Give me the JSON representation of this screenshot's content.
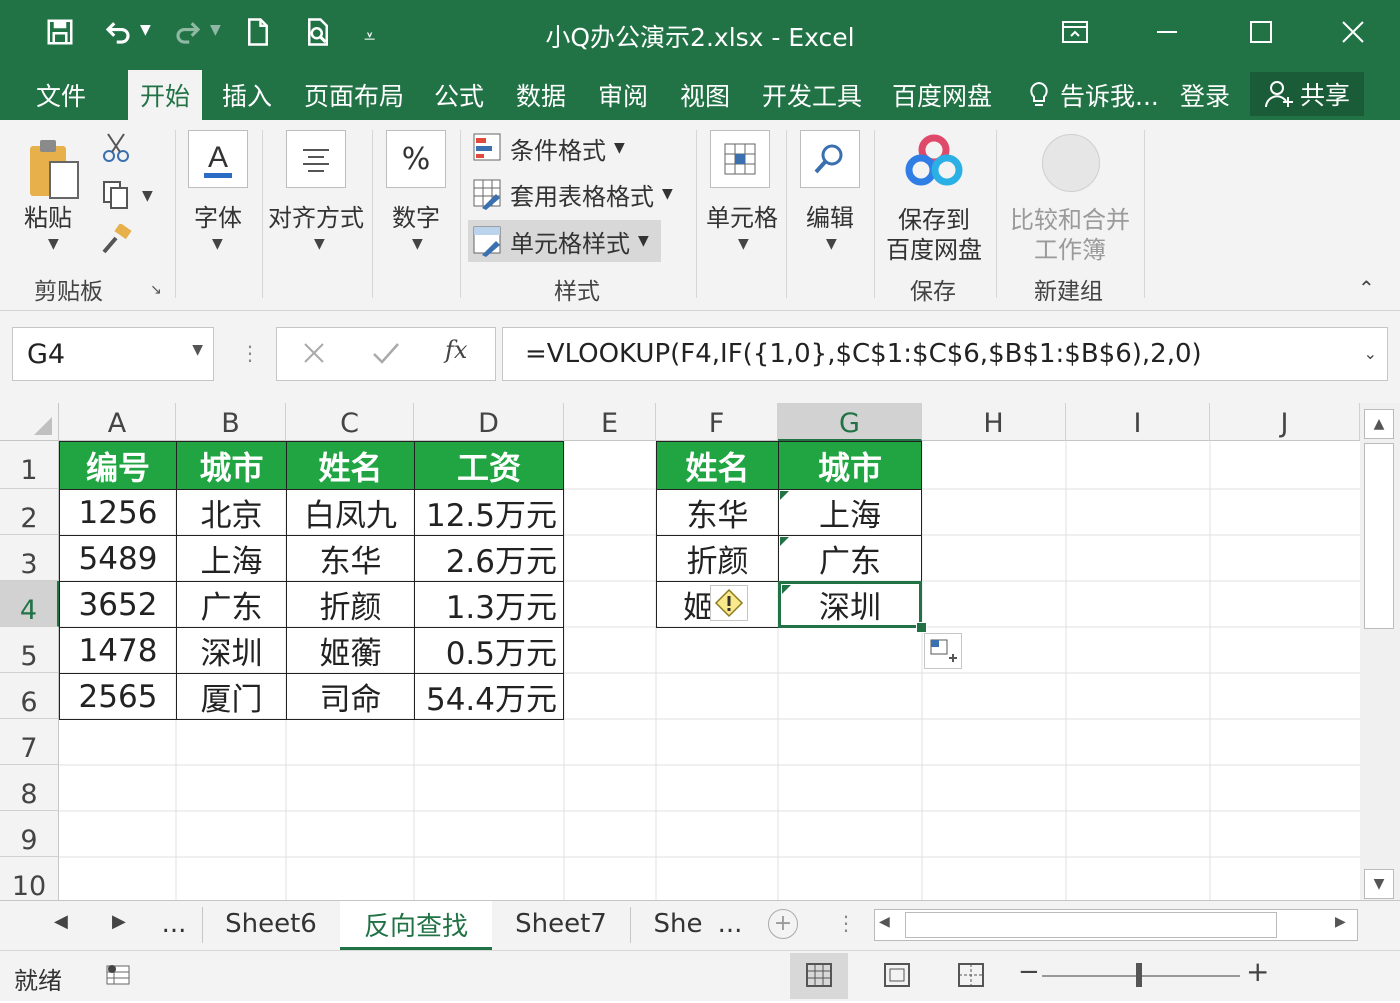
{
  "window": {
    "title": "小Q办公演示2.xlsx - Excel"
  },
  "ribbon_tabs": [
    "文件",
    "开始",
    "插入",
    "页面布局",
    "公式",
    "数据",
    "审阅",
    "视图",
    "开发工具",
    "百度网盘"
  ],
  "tell_me": "告诉我...",
  "login": "登录",
  "share": "共享",
  "ribbon": {
    "paste": "粘贴",
    "clipboard": "剪贴板",
    "font": "字体",
    "align": "对齐方式",
    "number": "数字",
    "cond_format": "条件格式",
    "table_format": "套用表格格式",
    "cell_style": "单元格样式",
    "styles": "样式",
    "cells": "单元格",
    "editing": "编辑",
    "save_to_line1": "保存到",
    "save_to_line2": "百度网盘",
    "save_group": "保存",
    "compare_line1": "比较和合并",
    "compare_line2": "工作簿",
    "new_group": "新建组"
  },
  "formula_bar": {
    "name_box": "G4",
    "formula": "=VLOOKUP(F4,IF({1,0},$C$1:$C$6,$B$1:$B$6),2,0)"
  },
  "grid": {
    "columns": [
      "A",
      "B",
      "C",
      "D",
      "E",
      "F",
      "G",
      "H",
      "I",
      "J"
    ],
    "rows": [
      "1",
      "2",
      "3",
      "4",
      "5",
      "6",
      "7",
      "8",
      "9",
      "10"
    ],
    "table1": {
      "headers": [
        "编号",
        "城市",
        "姓名",
        "工资"
      ],
      "rows": [
        [
          "1256",
          "北京",
          "白凤九",
          "12.5万元"
        ],
        [
          "5489",
          "上海",
          "东华",
          "2.6万元"
        ],
        [
          "3652",
          "广东",
          "折颜",
          "1.3万元"
        ],
        [
          "1478",
          "深圳",
          "姬蘅",
          "0.5万元"
        ],
        [
          "2565",
          "厦门",
          "司命",
          "54.4万元"
        ]
      ]
    },
    "table2": {
      "headers": [
        "姓名",
        "城市"
      ],
      "rows": [
        [
          "东华",
          "上海"
        ],
        [
          "折颜",
          "广东"
        ],
        [
          "姬",
          "深圳"
        ]
      ]
    }
  },
  "sheets": [
    "...",
    "Sheet6",
    "反向查找",
    "Sheet7",
    "She",
    "..."
  ],
  "status": {
    "ready": "就绪"
  },
  "colors": {
    "excel_green": "#217346",
    "header_green": "#21a542"
  }
}
